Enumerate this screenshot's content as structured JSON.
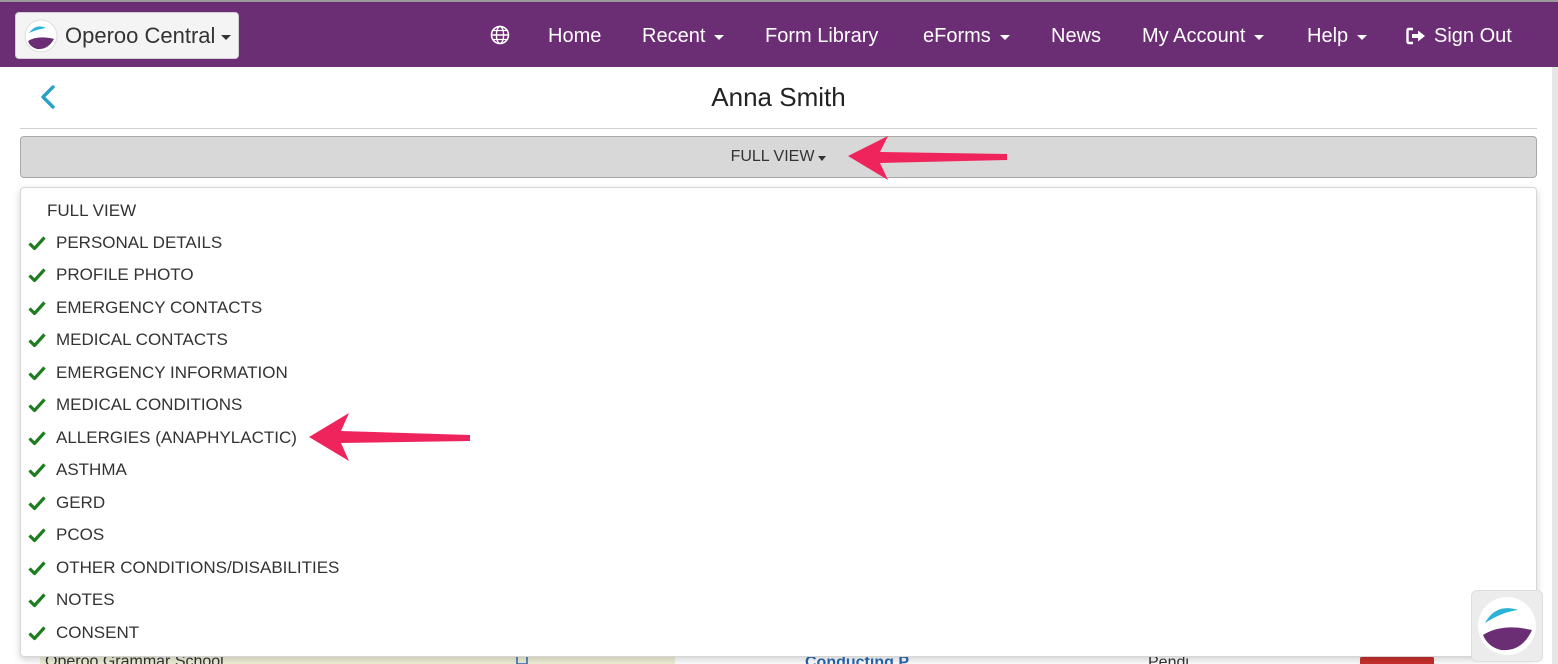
{
  "brand": {
    "label": "Operoo Central"
  },
  "nav": {
    "home": "Home",
    "recent": "Recent",
    "form_library": "Form Library",
    "eforms": "eForms",
    "news": "News",
    "my_account": "My Account",
    "help": "Help",
    "sign_out": "Sign Out"
  },
  "header": {
    "title": "Anna Smith"
  },
  "view_toggle": {
    "label": "FULL VIEW"
  },
  "menu": {
    "items": [
      {
        "label": "FULL VIEW",
        "checked": false
      },
      {
        "label": "PERSONAL DETAILS",
        "checked": true
      },
      {
        "label": "PROFILE PHOTO",
        "checked": true
      },
      {
        "label": "EMERGENCY CONTACTS",
        "checked": true
      },
      {
        "label": "MEDICAL CONTACTS",
        "checked": true
      },
      {
        "label": "EMERGENCY INFORMATION",
        "checked": true
      },
      {
        "label": "MEDICAL CONDITIONS",
        "checked": true
      },
      {
        "label": "ALLERGIES (ANAPHYLACTIC)",
        "checked": true
      },
      {
        "label": "ASTHMA",
        "checked": true
      },
      {
        "label": "GERD",
        "checked": true
      },
      {
        "label": "PCOS",
        "checked": true
      },
      {
        "label": "OTHER CONDITIONS/DISABILITIES",
        "checked": true
      },
      {
        "label": "NOTES",
        "checked": true
      },
      {
        "label": "CONSENT",
        "checked": true
      }
    ]
  },
  "background": {
    "school_name": "Operoo Grammar School",
    "link_text": "Conducting P",
    "text2": "Pendi"
  },
  "colors": {
    "navbar": "#6b2d74",
    "check": "#1e7d1e",
    "arrow": "#f0245d",
    "back_chevron": "#2aa0c8"
  },
  "icons": {
    "globe": "globe-icon",
    "sign_out": "sign-out-icon",
    "back": "chevron-left-icon",
    "check": "check-icon",
    "logo": "operoo-logo-icon"
  }
}
